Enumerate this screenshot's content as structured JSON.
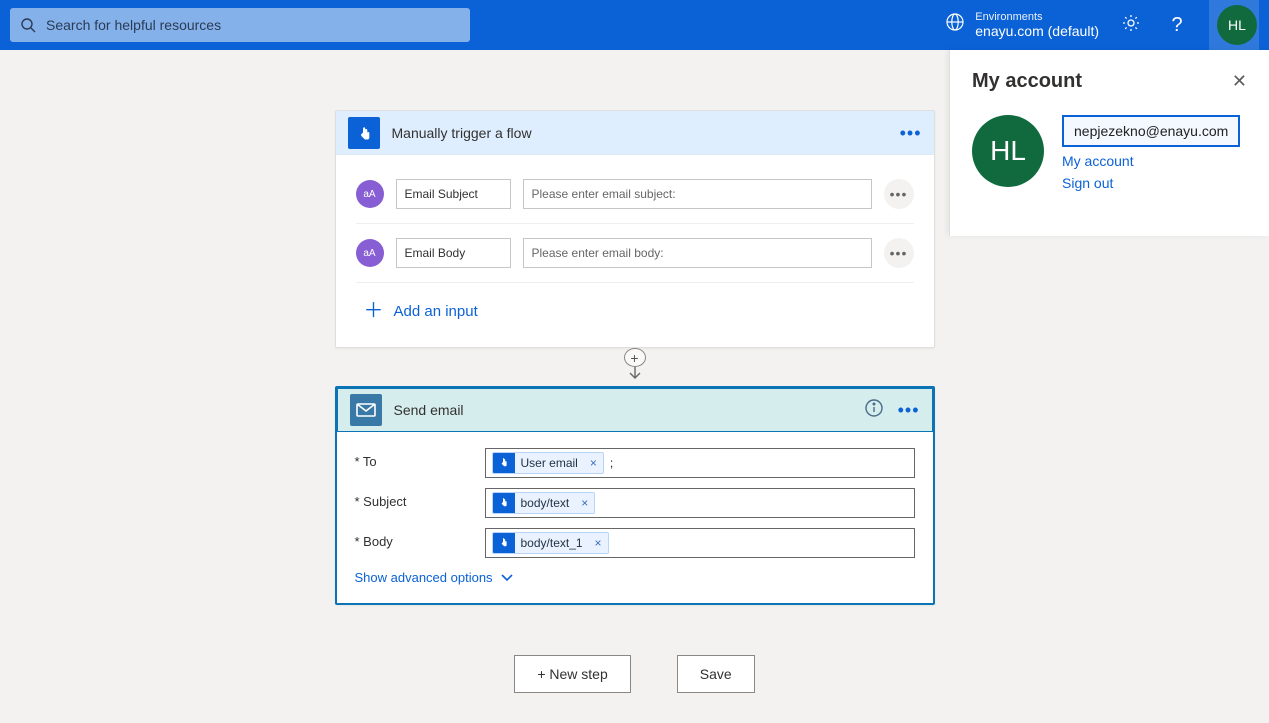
{
  "header": {
    "search_placeholder": "Search for helpful resources",
    "env_label": "Environments",
    "env_name": "enayu.com (default)",
    "avatar_initials": "HL"
  },
  "trigger": {
    "title": "Manually trigger a flow",
    "inputs": [
      {
        "label": "Email Subject",
        "placeholder": "Please enter email subject:"
      },
      {
        "label": "Email Body",
        "placeholder": "Please enter email body:"
      }
    ],
    "add_input": "Add an input"
  },
  "action": {
    "title": "Send email",
    "params": {
      "to": {
        "label": "* To",
        "token": "User email",
        "suffix": ";"
      },
      "subject": {
        "label": "* Subject",
        "token": "body/text"
      },
      "body": {
        "label": "* Body",
        "token": "body/text_1"
      }
    },
    "advanced": "Show advanced options"
  },
  "buttons": {
    "new_step": "+ New step",
    "save": "Save"
  },
  "account_panel": {
    "title": "My account",
    "avatar_initials": "HL",
    "email": "nepjezekno@enayu.com",
    "my_account_link": "My account",
    "signout_link": "Sign out"
  }
}
